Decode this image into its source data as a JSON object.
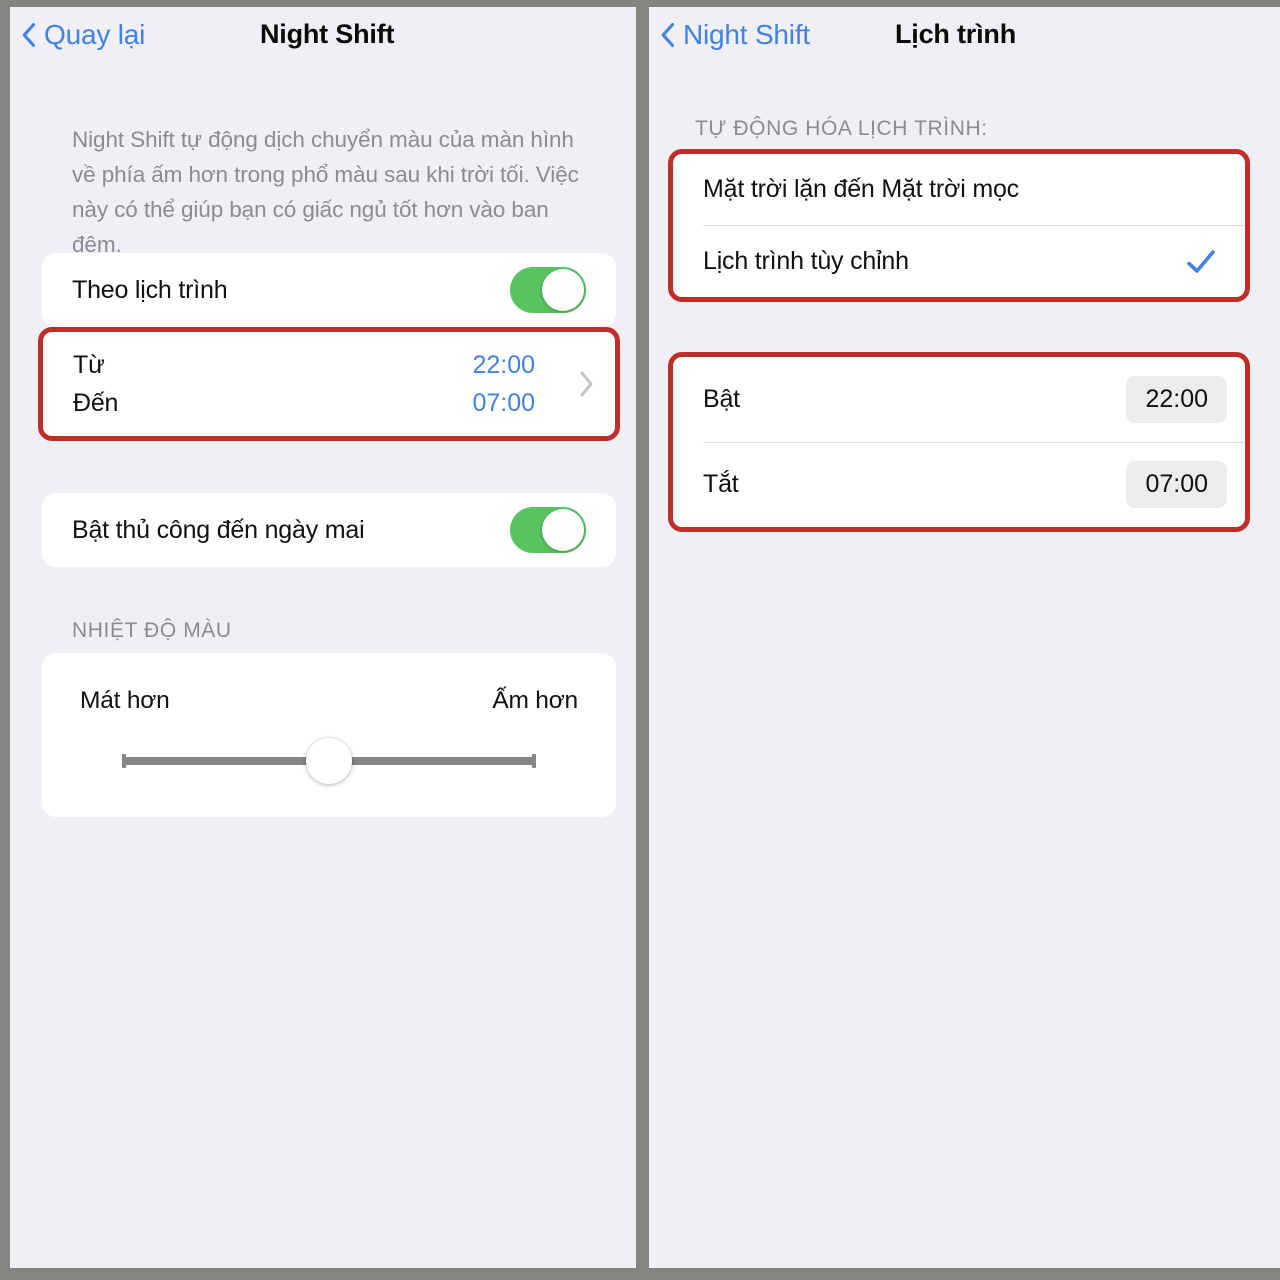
{
  "theme": {
    "page_bg": "#868480",
    "panel_bg": "#f0eff4",
    "card_bg": "#ffffff",
    "accent_blue": "#3f82e8",
    "toggle_green": "#59c45f",
    "highlight_red": "#bf2f2a",
    "secondary_text": "#8b8b95",
    "primary_text": "#111114",
    "pill_bg": "#ececed"
  },
  "left_panel": {
    "navbar": {
      "back_label": "Quay lại",
      "back_icon": "chevron-left-icon",
      "title": "Night Shift"
    },
    "description": "Night Shift tự động dịch chuyển màu của màn hình về phía ấm hơn trong phổ màu sau khi trời tối. Việc này có thể giúp bạn có giấc ngủ tốt hơn vào ban đêm.",
    "schedule_toggle": {
      "label": "Theo lịch trình",
      "state": "on"
    },
    "from_to": {
      "highlighted": true,
      "rows": [
        {
          "label": "Từ",
          "value": "22:00"
        },
        {
          "label": "Đến",
          "value": "07:00"
        }
      ],
      "disclosure_icon": "chevron-right-icon"
    },
    "manual_toggle": {
      "label": "Bật thủ công đến ngày mai",
      "state": "on"
    },
    "color_temperature": {
      "header": "NHIỆT ĐỘ MÀU",
      "left_label": "Mát hơn",
      "right_label": "Ấm hơn",
      "slider_value_percent": 50
    }
  },
  "right_panel": {
    "navbar": {
      "back_label": "Night Shift",
      "back_icon": "chevron-left-icon",
      "title": "Lịch trình"
    },
    "automation": {
      "header": "TỰ ĐỘNG HÓA LỊCH TRÌNH:",
      "highlighted": true,
      "options": [
        {
          "label": "Mặt trời lặn đến Mặt trời mọc",
          "selected": false
        },
        {
          "label": "Lịch trình tùy chỉnh",
          "selected": true,
          "check_icon": "checkmark-icon"
        }
      ]
    },
    "custom_times": {
      "highlighted": true,
      "rows": [
        {
          "label": "Bật",
          "value": "22:00"
        },
        {
          "label": "Tắt",
          "value": "07:00"
        }
      ]
    }
  }
}
